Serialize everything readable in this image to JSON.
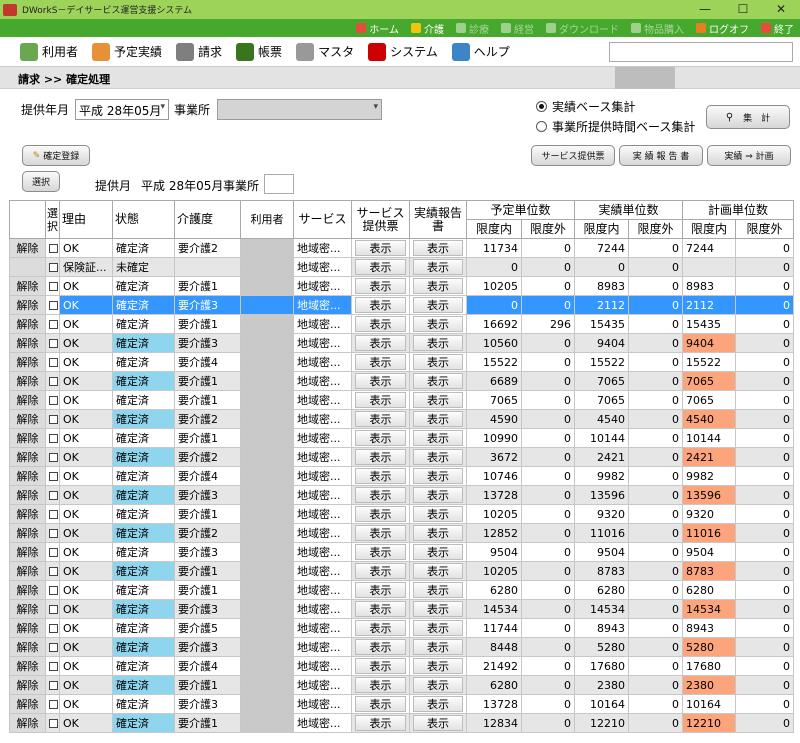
{
  "titlebar": {
    "title": "DWorkS－デイサービス運営支援システム",
    "minimize": "—",
    "maximize": "☐",
    "close": "✕"
  },
  "appbar": [
    {
      "label": "ホーム",
      "enabled": true,
      "icon": "home-icon",
      "color": "#e74c3c"
    },
    {
      "label": "介護",
      "enabled": true,
      "icon": "care-icon",
      "color": "#f1c40f"
    },
    {
      "label": "診療",
      "enabled": false,
      "icon": "medical-icon",
      "color": "#9fd08d"
    },
    {
      "label": "経営",
      "enabled": false,
      "icon": "business-icon",
      "color": "#9fd08d"
    },
    {
      "label": "ダウンロード",
      "enabled": false,
      "icon": "download-icon",
      "color": "#9fd08d"
    },
    {
      "label": "物品購入",
      "enabled": false,
      "icon": "purchase-icon",
      "color": "#9fd08d"
    },
    {
      "label": "ログオフ",
      "enabled": true,
      "icon": "logoff-icon",
      "color": "#e67e22"
    },
    {
      "label": "終了",
      "enabled": true,
      "icon": "exit-icon",
      "color": "#e74c3c"
    }
  ],
  "menu": [
    {
      "label": "利用者",
      "icon": "users-icon",
      "color": "#6aa84f"
    },
    {
      "label": "予定実績",
      "icon": "pencil-icon",
      "color": "#e69138"
    },
    {
      "label": "請求",
      "icon": "calculator-icon",
      "color": "#7f7f7f"
    },
    {
      "label": "帳票",
      "icon": "book-icon",
      "color": "#38761d"
    },
    {
      "label": "マスタ",
      "icon": "database-icon",
      "color": "#999999"
    },
    {
      "label": "システム",
      "icon": "tools-icon",
      "color": "#cc0000"
    },
    {
      "label": "ヘルプ",
      "icon": "help-icon",
      "color": "#3d85c6"
    }
  ],
  "breadcrumb": "請求 >> 確定処理",
  "filter": {
    "month_label": "提供年月",
    "month_value": "平成 28年05月",
    "office_label": "事業所",
    "office_value": "",
    "radio1": "実績ベース集計",
    "radio2": "事業所提供時間ベース集計",
    "calc_button": "集　計",
    "confirm_button": "確定登録",
    "select_button": "選択",
    "service_slip_button": "サービス提供票",
    "report_button": "実 績 報 告 書",
    "plan_button": "実績 ⇒ 計画",
    "info_month_label": "提供月",
    "info_month_value": "平成 28年05月",
    "info_office_label": "事業所"
  },
  "grid": {
    "headers": {
      "select": "選択",
      "reason": "理由",
      "status": "状態",
      "care": "介護度",
      "user": "利用者",
      "service": "サービス",
      "slip": "サービス提供票",
      "report": "実績報告書",
      "yotei": "予定単位数",
      "jisseki": "実績単位数",
      "keikaku": "計画単位数",
      "in": "限度内",
      "out": "限度外"
    },
    "rows": [
      {
        "kaijo": "解除",
        "reason": "OK",
        "status": "確定済",
        "care": "要介護2",
        "svc": "地域密...",
        "slip": "表示",
        "report": "表示",
        "y_in": "11734",
        "y_out": "0",
        "j_in": "7244",
        "j_out": "0",
        "k_in": "7244",
        "k_out": "0"
      },
      {
        "kaijo": "",
        "reason": "保険証...",
        "status": "未確定",
        "care": "",
        "svc": "地域密...",
        "slip": "表示",
        "report": "表示",
        "y_in": "0",
        "y_out": "0",
        "j_in": "0",
        "j_out": "0",
        "k_in": "",
        "k_out": "0"
      },
      {
        "kaijo": "解除",
        "reason": "OK",
        "status": "確定済",
        "care": "要介護1",
        "svc": "地域密...",
        "slip": "表示",
        "report": "表示",
        "y_in": "10205",
        "y_out": "0",
        "j_in": "8983",
        "j_out": "0",
        "k_in": "8983",
        "k_out": "0"
      },
      {
        "kaijo": "解除",
        "reason": "OK",
        "status": "確定済",
        "care": "要介護3",
        "svc": "地域密...",
        "slip": "表示",
        "report": "表示",
        "y_in": "0",
        "y_out": "0",
        "j_in": "2112",
        "j_out": "0",
        "k_in": "2112",
        "k_out": "0"
      },
      {
        "kaijo": "解除",
        "reason": "OK",
        "status": "確定済",
        "care": "要介護1",
        "svc": "地域密...",
        "slip": "表示",
        "report": "表示",
        "y_in": "16692",
        "y_out": "296",
        "j_in": "15435",
        "j_out": "0",
        "k_in": "15435",
        "k_out": "0"
      },
      {
        "kaijo": "解除",
        "reason": "OK",
        "status": "確定済",
        "care": "要介護3",
        "svc": "地域密...",
        "slip": "表示",
        "report": "表示",
        "y_in": "10560",
        "y_out": "0",
        "j_in": "9404",
        "j_out": "0",
        "k_in": "9404",
        "k_out": "0"
      },
      {
        "kaijo": "解除",
        "reason": "OK",
        "status": "確定済",
        "care": "要介護4",
        "svc": "地域密...",
        "slip": "表示",
        "report": "表示",
        "y_in": "15522",
        "y_out": "0",
        "j_in": "15522",
        "j_out": "0",
        "k_in": "15522",
        "k_out": "0"
      },
      {
        "kaijo": "解除",
        "reason": "OK",
        "status": "確定済",
        "care": "要介護1",
        "svc": "地域密...",
        "slip": "表示",
        "report": "表示",
        "y_in": "6689",
        "y_out": "0",
        "j_in": "7065",
        "j_out": "0",
        "k_in": "7065",
        "k_out": "0"
      },
      {
        "kaijo": "解除",
        "reason": "OK",
        "status": "確定済",
        "care": "要介護1",
        "svc": "地域密...",
        "slip": "表示",
        "report": "表示",
        "y_in": "7065",
        "y_out": "0",
        "j_in": "7065",
        "j_out": "0",
        "k_in": "7065",
        "k_out": "0"
      },
      {
        "kaijo": "解除",
        "reason": "OK",
        "status": "確定済",
        "care": "要介護2",
        "svc": "地域密...",
        "slip": "表示",
        "report": "表示",
        "y_in": "4590",
        "y_out": "0",
        "j_in": "4540",
        "j_out": "0",
        "k_in": "4540",
        "k_out": "0"
      },
      {
        "kaijo": "解除",
        "reason": "OK",
        "status": "確定済",
        "care": "要介護1",
        "svc": "地域密...",
        "slip": "表示",
        "report": "表示",
        "y_in": "10990",
        "y_out": "0",
        "j_in": "10144",
        "j_out": "0",
        "k_in": "10144",
        "k_out": "0"
      },
      {
        "kaijo": "解除",
        "reason": "OK",
        "status": "確定済",
        "care": "要介護2",
        "svc": "地域密...",
        "slip": "表示",
        "report": "表示",
        "y_in": "3672",
        "y_out": "0",
        "j_in": "2421",
        "j_out": "0",
        "k_in": "2421",
        "k_out": "0"
      },
      {
        "kaijo": "解除",
        "reason": "OK",
        "status": "確定済",
        "care": "要介護4",
        "svc": "地域密...",
        "slip": "表示",
        "report": "表示",
        "y_in": "10746",
        "y_out": "0",
        "j_in": "9982",
        "j_out": "0",
        "k_in": "9982",
        "k_out": "0"
      },
      {
        "kaijo": "解除",
        "reason": "OK",
        "status": "確定済",
        "care": "要介護3",
        "svc": "地域密...",
        "slip": "表示",
        "report": "表示",
        "y_in": "13728",
        "y_out": "0",
        "j_in": "13596",
        "j_out": "0",
        "k_in": "13596",
        "k_out": "0"
      },
      {
        "kaijo": "解除",
        "reason": "OK",
        "status": "確定済",
        "care": "要介護1",
        "svc": "地域密...",
        "slip": "表示",
        "report": "表示",
        "y_in": "10205",
        "y_out": "0",
        "j_in": "9320",
        "j_out": "0",
        "k_in": "9320",
        "k_out": "0"
      },
      {
        "kaijo": "解除",
        "reason": "OK",
        "status": "確定済",
        "care": "要介護2",
        "svc": "地域密...",
        "slip": "表示",
        "report": "表示",
        "y_in": "12852",
        "y_out": "0",
        "j_in": "11016",
        "j_out": "0",
        "k_in": "11016",
        "k_out": "0"
      },
      {
        "kaijo": "解除",
        "reason": "OK",
        "status": "確定済",
        "care": "要介護3",
        "svc": "地域密...",
        "slip": "表示",
        "report": "表示",
        "y_in": "9504",
        "y_out": "0",
        "j_in": "9504",
        "j_out": "0",
        "k_in": "9504",
        "k_out": "0"
      },
      {
        "kaijo": "解除",
        "reason": "OK",
        "status": "確定済",
        "care": "要介護1",
        "svc": "地域密...",
        "slip": "表示",
        "report": "表示",
        "y_in": "10205",
        "y_out": "0",
        "j_in": "8783",
        "j_out": "0",
        "k_in": "8783",
        "k_out": "0"
      },
      {
        "kaijo": "解除",
        "reason": "OK",
        "status": "確定済",
        "care": "要介護1",
        "svc": "地域密...",
        "slip": "表示",
        "report": "表示",
        "y_in": "6280",
        "y_out": "0",
        "j_in": "6280",
        "j_out": "0",
        "k_in": "6280",
        "k_out": "0"
      },
      {
        "kaijo": "解除",
        "reason": "OK",
        "status": "確定済",
        "care": "要介護3",
        "svc": "地域密...",
        "slip": "表示",
        "report": "表示",
        "y_in": "14534",
        "y_out": "0",
        "j_in": "14534",
        "j_out": "0",
        "k_in": "14534",
        "k_out": "0"
      },
      {
        "kaijo": "解除",
        "reason": "OK",
        "status": "確定済",
        "care": "要介護5",
        "svc": "地域密...",
        "slip": "表示",
        "report": "表示",
        "y_in": "11744",
        "y_out": "0",
        "j_in": "8943",
        "j_out": "0",
        "k_in": "8943",
        "k_out": "0"
      },
      {
        "kaijo": "解除",
        "reason": "OK",
        "status": "確定済",
        "care": "要介護3",
        "svc": "地域密...",
        "slip": "表示",
        "report": "表示",
        "y_in": "8448",
        "y_out": "0",
        "j_in": "5280",
        "j_out": "0",
        "k_in": "5280",
        "k_out": "0"
      },
      {
        "kaijo": "解除",
        "reason": "OK",
        "status": "確定済",
        "care": "要介護4",
        "svc": "地域密...",
        "slip": "表示",
        "report": "表示",
        "y_in": "21492",
        "y_out": "0",
        "j_in": "17680",
        "j_out": "0",
        "k_in": "17680",
        "k_out": "0"
      },
      {
        "kaijo": "解除",
        "reason": "OK",
        "status": "確定済",
        "care": "要介護1",
        "svc": "地域密...",
        "slip": "表示",
        "report": "表示",
        "y_in": "6280",
        "y_out": "0",
        "j_in": "2380",
        "j_out": "0",
        "k_in": "2380",
        "k_out": "0"
      },
      {
        "kaijo": "解除",
        "reason": "OK",
        "status": "確定済",
        "care": "要介護3",
        "svc": "地域密...",
        "slip": "表示",
        "report": "表示",
        "y_in": "13728",
        "y_out": "0",
        "j_in": "10164",
        "j_out": "0",
        "k_in": "10164",
        "k_out": "0"
      },
      {
        "kaijo": "解除",
        "reason": "OK",
        "status": "確定済",
        "care": "要介護1",
        "svc": "地域密...",
        "slip": "表示",
        "report": "表示",
        "y_in": "12834",
        "y_out": "0",
        "j_in": "12210",
        "j_out": "0",
        "k_in": "12210",
        "k_out": "0"
      }
    ],
    "selected_row": 3,
    "unconfirmed_row": 1
  },
  "colors": {
    "titlebar": "#9ed35a",
    "appbar": "#46a82d",
    "status_confirmed": "#8fd5ee",
    "plan_highlight": "#fca47c",
    "selection": "#3397ff"
  }
}
